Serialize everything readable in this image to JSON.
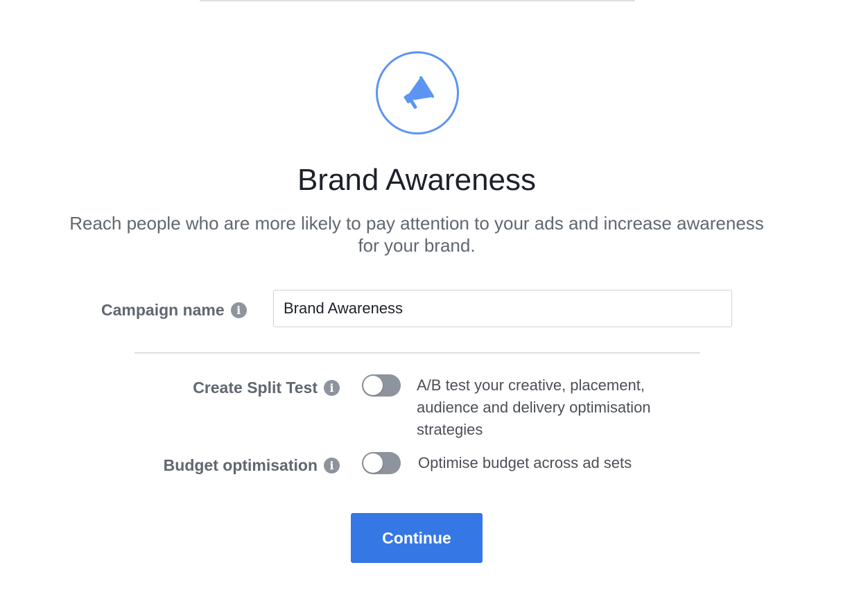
{
  "objective": {
    "icon": "megaphone-icon",
    "accent_color": "#5b94f2",
    "title": "Brand Awareness",
    "description": "Reach people who are more likely to pay attention to your ads and increase awareness for your brand."
  },
  "campaign_name": {
    "label": "Campaign name",
    "value": "Brand Awareness",
    "info_icon": "info-icon"
  },
  "split_test": {
    "label": "Create Split Test",
    "enabled": false,
    "description": "A/B test your creative, placement, audience and delivery optimisation strategies",
    "info_icon": "info-icon"
  },
  "budget_optimisation": {
    "label": "Budget optimisation",
    "enabled": false,
    "description": "Optimise budget across ad sets",
    "info_icon": "info-icon"
  },
  "continue_button": {
    "label": "Continue",
    "color": "#3578e5"
  }
}
